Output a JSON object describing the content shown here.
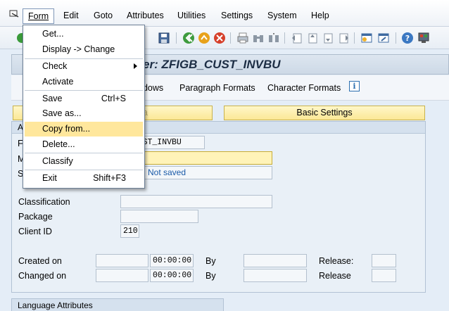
{
  "menubar": {
    "items": [
      "Form",
      "Edit",
      "Goto",
      "Attributes",
      "Utilities",
      "Settings",
      "System",
      "Help"
    ]
  },
  "title": {
    "visible_text": "er: ZFIGB_CUST_INVBU"
  },
  "app_toolbar": {
    "windows": "ndows",
    "paragraph_formats": "Paragraph Formats",
    "character_formats": "Character Formats"
  },
  "tabs": {
    "left_partial": "a",
    "basic_settings": "Basic Settings"
  },
  "panel": {
    "header_partial": "A",
    "form_name_label_partial": "F",
    "form_name_value": "B_CUST_INVBU",
    "meaning_label_partial": "M",
    "status_label_partial": "S",
    "status_value": "Not saved",
    "classification_label": "Classification",
    "classification_value": "",
    "package_label": "Package",
    "package_value": "",
    "client_label": "Client ID",
    "client_value": "210",
    "created_on_label": "Created on",
    "created_on_date": "",
    "created_on_time": "00:00:00",
    "created_by_label": "By",
    "created_by_value": "",
    "created_release_label": "Release:",
    "created_release_value": "",
    "changed_on_label": "Changed on",
    "changed_on_date": "",
    "changed_on_time": "00:00:00",
    "changed_by_label": "By",
    "changed_by_value": "",
    "changed_release_label": "Release",
    "changed_release_value": ""
  },
  "language_panel": {
    "header": "Language Attributes"
  },
  "dropdown": {
    "get": "Get...",
    "display_change": "Display -> Change",
    "check": "Check",
    "activate": "Activate",
    "save": "Save",
    "save_shortcut": "Ctrl+S",
    "save_as": "Save as...",
    "copy_from": "Copy from...",
    "delete": "Delete...",
    "classify": "Classify",
    "exit": "Exit",
    "exit_shortcut": "Shift+F3"
  },
  "colors": {
    "highlight": "#ffe79c",
    "button_yellow": "#fbe795",
    "panel_bg": "#e9f0f7"
  }
}
